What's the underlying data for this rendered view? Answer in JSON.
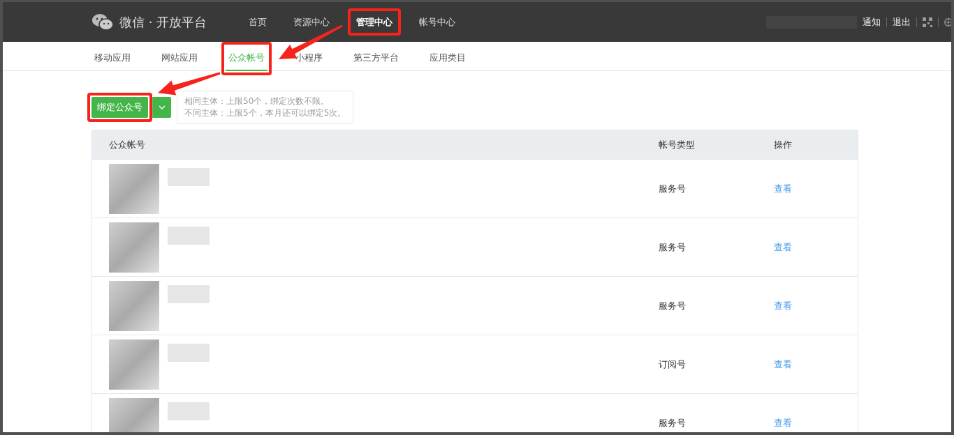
{
  "brand": {
    "title": "微信 · 开放平台"
  },
  "top_nav": [
    {
      "label": "首页",
      "selected": false,
      "highlighted": false
    },
    {
      "label": "资源中心",
      "selected": false,
      "highlighted": false
    },
    {
      "label": "管理中心",
      "selected": true,
      "highlighted": true
    },
    {
      "label": "帐号中心",
      "selected": false,
      "highlighted": false
    }
  ],
  "user_links": [
    {
      "label": "通知"
    },
    {
      "label": "退出"
    }
  ],
  "sub_nav": [
    {
      "label": "移动应用",
      "selected": false,
      "highlighted": false
    },
    {
      "label": "网站应用",
      "selected": false,
      "highlighted": false
    },
    {
      "label": "公众帐号",
      "selected": true,
      "highlighted": true
    },
    {
      "label": "小程序",
      "selected": false,
      "highlighted": false
    },
    {
      "label": "第三方平台",
      "selected": false,
      "highlighted": false
    },
    {
      "label": "应用类目",
      "selected": false,
      "highlighted": false
    }
  ],
  "bind_button": {
    "label": "绑定公众号",
    "highlighted": true
  },
  "hint_lines": [
    "相同主体：上限50个，绑定次数不限。",
    "不同主体：上限5个，本月还可以绑定5次。"
  ],
  "table": {
    "columns": [
      "公众帐号",
      "帐号类型",
      "操作"
    ],
    "rows": [
      {
        "account_type": "服务号",
        "action": "查看"
      },
      {
        "account_type": "服务号",
        "action": "查看"
      },
      {
        "account_type": "服务号",
        "action": "查看"
      },
      {
        "account_type": "订阅号",
        "action": "查看"
      },
      {
        "account_type": "服务号",
        "action": "查看"
      }
    ]
  }
}
